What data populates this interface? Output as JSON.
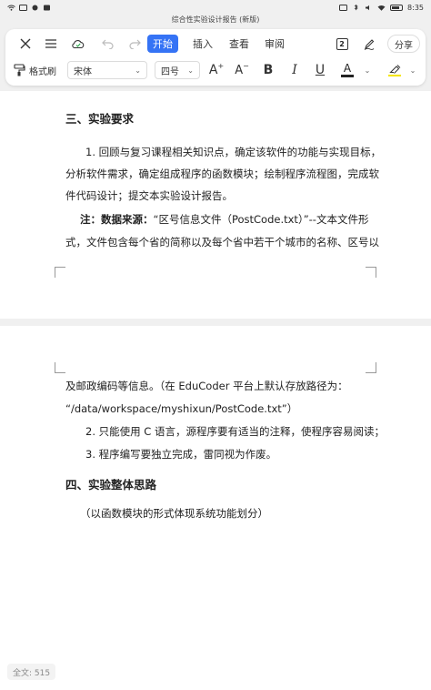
{
  "status": {
    "time": "8:35",
    "battery_icon": "battery-icon"
  },
  "window": {
    "title": "综合性实验设计报告 (新版)"
  },
  "tabs": [
    {
      "label": "开始",
      "active": true
    },
    {
      "label": "插入",
      "active": false
    },
    {
      "label": "查看",
      "active": false
    },
    {
      "label": "审阅",
      "active": false
    }
  ],
  "toolbar": {
    "share_label": "分享",
    "doc_count_badge": "2",
    "format_painter_label": "格式刷",
    "font_family": "宋体",
    "font_size": "四号",
    "bold": "B",
    "italic": "I",
    "underline": "U",
    "font_color_glyph": "A",
    "grow_font": "A",
    "shrink_font": "A",
    "font_color": "#222222",
    "highlight_color": "#f5e600",
    "accent": "#3573f5"
  },
  "document": {
    "page1": {
      "heading": "三、实验要求",
      "p1_line1": "1. 回顾与复习课程相关知识点，确定该软件的功能与实现目标，",
      "p1_line2": "分析软件需求，确定组成程序的函数模块；绘制程序流程图，完成软",
      "p1_line3": "件代码设计；提交本实验设计报告。",
      "note_bold": "注：数据来源：",
      "note_line1": "“区号信息文件（PostCode.txt）”--文本文件形",
      "note_line2": "式，文件包含每个省的简称以及每个省中若干个城市的名称、区号以"
    },
    "page2": {
      "line1": "及邮政编码等信息。（在 EduCoder 平台上默认存放路径为：",
      "line2": "“/data/workspace/myshixun/PostCode.txt”）",
      "item2": "2. 只能使用 C 语言，源程序要有适当的注释，使程序容易阅读；",
      "item3": "3. 程序编写要独立完成，雷同视为作废。",
      "heading": "四、实验整体思路",
      "subtitle": "（以函数模块的形式体现系统功能划分）"
    }
  },
  "footer": {
    "word_count": "全文: 515"
  }
}
